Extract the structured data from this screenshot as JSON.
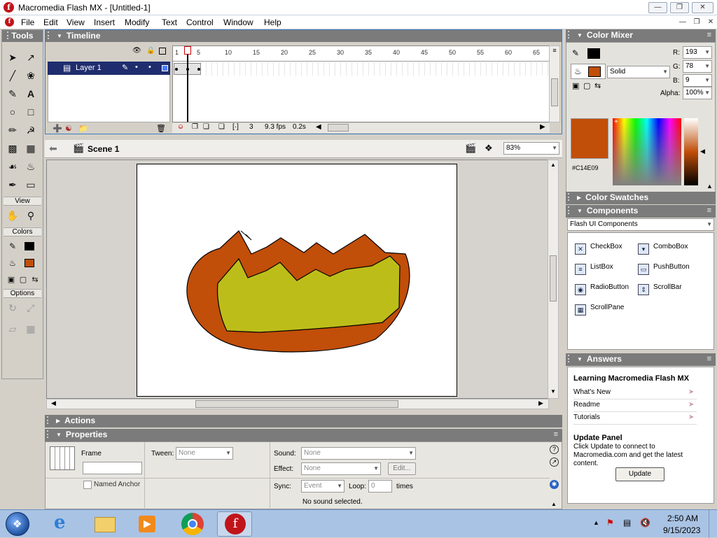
{
  "window": {
    "title": "Macromedia Flash MX - [Untitled-1]",
    "app_icon": "flash-icon",
    "controls": [
      "minimize",
      "maximize",
      "close"
    ]
  },
  "menu": {
    "items": [
      "File",
      "Edit",
      "View",
      "Insert",
      "Modify",
      "Text",
      "Control",
      "Window",
      "Help"
    ]
  },
  "tools_panel": {
    "title": "Tools",
    "sections": {
      "view": "View",
      "colors": "Colors",
      "options": "Options"
    },
    "stroke_color": "#000000",
    "fill_color": "#C14E09"
  },
  "timeline": {
    "title": "Timeline",
    "layer_name": "Layer 1",
    "ruler": [
      "1",
      "5",
      "10",
      "15",
      "20",
      "25",
      "30",
      "35",
      "40",
      "45",
      "50",
      "55",
      "60",
      "65"
    ],
    "current_frame": "3",
    "frame_rate": "9.3 fps",
    "elapsed_time": "0.2s"
  },
  "scene": {
    "name": "Scene 1",
    "zoom": "83%"
  },
  "drawing": {
    "outer_fill": "#C14E09",
    "inner_fill": "#BDBD1A",
    "stroke": "#000000"
  },
  "actions_panel": {
    "title": "Actions"
  },
  "properties_panel": {
    "title": "Properties",
    "frame_label": "Frame",
    "named_anchor": "Named Anchor",
    "tween_label": "Tween:",
    "tween_value": "None",
    "sound_label": "Sound:",
    "sound_value": "None",
    "effect_label": "Effect:",
    "effect_value": "None",
    "edit_button": "Edit...",
    "sync_label": "Sync:",
    "sync_value": "Event",
    "loop_label": "Loop:",
    "loop_value": "0",
    "times_label": "times",
    "status": "No sound selected."
  },
  "color_mixer": {
    "title": "Color Mixer",
    "fill_type": "Solid",
    "r_label": "R:",
    "r": "193",
    "g_label": "G:",
    "g": "78",
    "b_label": "B:",
    "b": "9",
    "alpha_label": "Alpha:",
    "alpha": "100%",
    "hex": "#C14E09"
  },
  "color_swatches": {
    "title": "Color Swatches"
  },
  "components": {
    "title": "Components",
    "set": "Flash UI Components",
    "items": [
      "CheckBox",
      "ComboBox",
      "ListBox",
      "PushButton",
      "RadioButton",
      "ScrollBar",
      "ScrollPane"
    ]
  },
  "answers": {
    "title": "Answers",
    "heading": "Learning Macromedia Flash MX",
    "links": [
      "What's New",
      "Readme",
      "Tutorials"
    ],
    "update_heading": "Update Panel",
    "update_text": "Click Update to connect to Macromedia.com and get the latest content.",
    "update_button": "Update"
  },
  "taskbar": {
    "time": "2:50 AM",
    "date": "9/15/2023"
  }
}
